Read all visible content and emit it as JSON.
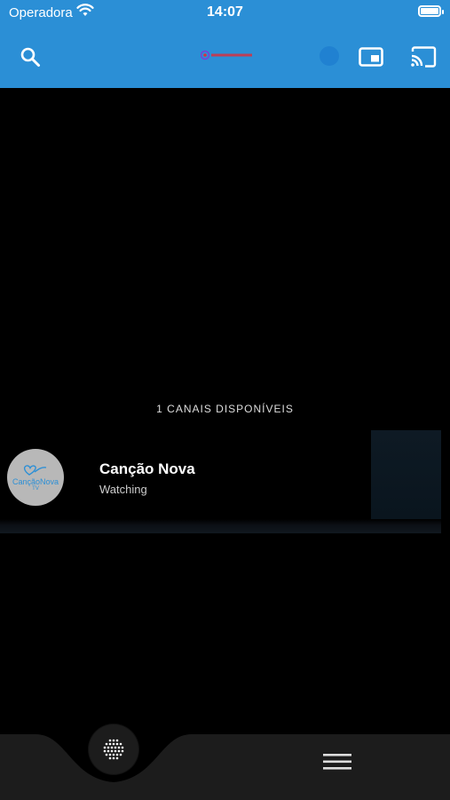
{
  "status_bar": {
    "carrier": "Operadora",
    "time": "14:07"
  },
  "app_bar": {
    "icons": [
      "search-icon",
      "app-logo",
      "cast-status-icon",
      "picture-in-picture-icon",
      "cast-icon"
    ]
  },
  "channels": {
    "count_label": "1 CANAIS DISPONÍVEIS",
    "items": [
      {
        "name": "Canção Nova",
        "status": "Watching",
        "logo_text": "CançãoNova",
        "logo_sub": "TV"
      }
    ]
  },
  "bottom_nav": {
    "icons": [
      "keypad-icon",
      "menu-icon"
    ]
  },
  "colors": {
    "primary": "#2b8fd6",
    "background": "#000000",
    "bottom_bar": "#1c1c1c"
  }
}
